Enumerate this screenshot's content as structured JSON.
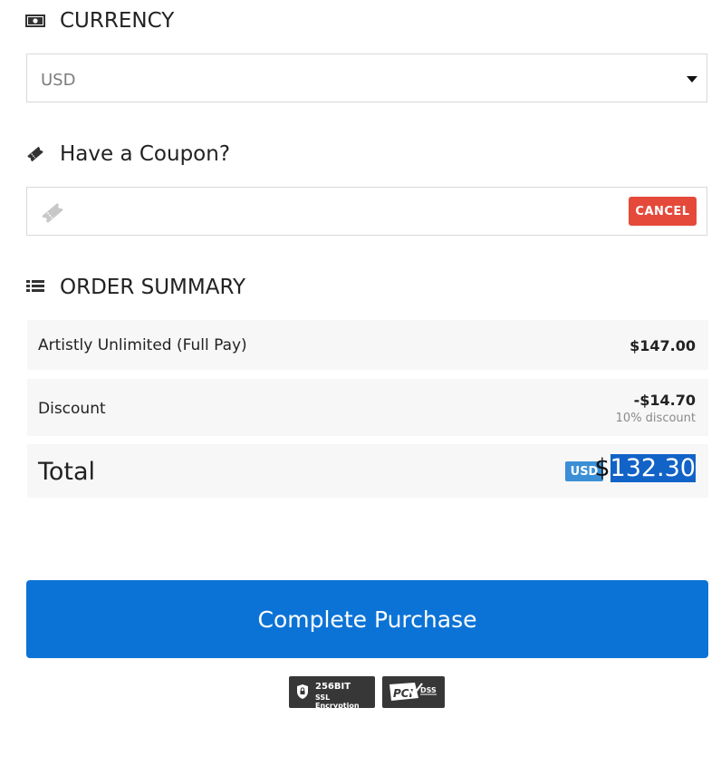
{
  "currency_section": {
    "title": "CURRENCY",
    "icon": "money-icon",
    "selected": "USD"
  },
  "coupon_section": {
    "title": "Have a Coupon?",
    "icon": "ticket-icon",
    "input_value": "",
    "cancel_label": "CANCEL"
  },
  "order_summary": {
    "title": "ORDER SUMMARY",
    "icon": "list-icon",
    "items": [
      {
        "label": "Artistly Unlimited (Full Pay)",
        "amount": "$147.00"
      }
    ],
    "discount": {
      "label": "Discount",
      "amount": "-$14.70",
      "note": "10% discount"
    },
    "total": {
      "label": "Total",
      "currency_badge": "USD",
      "symbol": "$",
      "amount": "132.30"
    }
  },
  "purchase_button": {
    "label": "Complete Purchase"
  },
  "badges": {
    "ssl_line1": "256BIT",
    "ssl_line2": "SSL Encryption",
    "pci_text": "PCI",
    "dss_text": "DSS"
  },
  "colors": {
    "primary": "#0c73d6",
    "cancel": "#e5493a",
    "badge": "#3b8fd6",
    "row_bg": "#f7f7f7"
  }
}
